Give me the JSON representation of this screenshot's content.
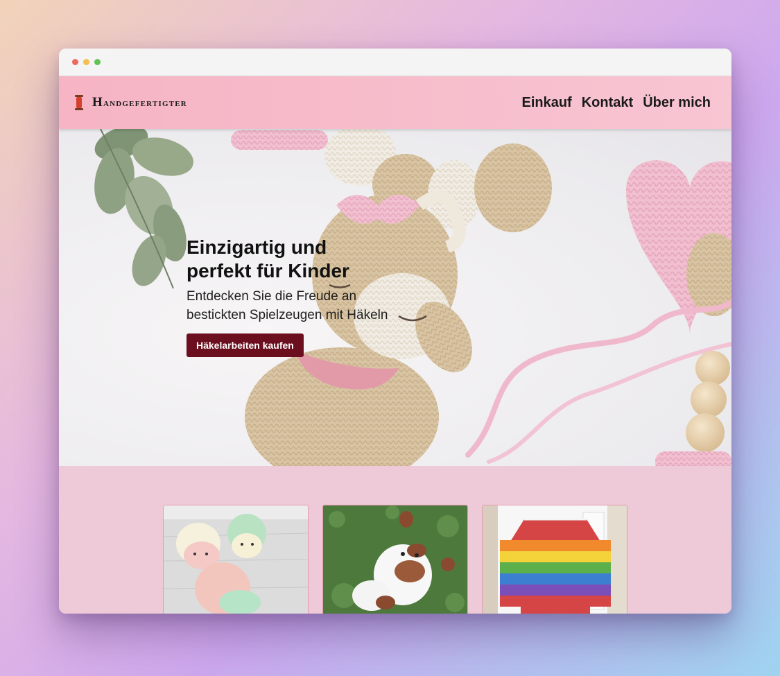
{
  "window": {
    "controls": [
      "close",
      "minimize",
      "maximize"
    ]
  },
  "navbar": {
    "brand_icon": "thread-spool-icon",
    "brand_name": "Handgefertigter",
    "links": [
      {
        "label": "Einkauf"
      },
      {
        "label": "Kontakt"
      },
      {
        "label": "Über mich"
      }
    ]
  },
  "hero": {
    "title_line1": "Einzigartig und",
    "title_line2": "perfekt für Kinder",
    "subtitle_line1": "Entdecken Sie die Freude an",
    "subtitle_line2": "bestickten Spielzeugen mit Häkeln",
    "cta_label": "Häkelarbeiten kaufen",
    "image": "crocheted deer toy with pink heart and teething beads"
  },
  "products": [
    {
      "image": "crocheted turtles"
    },
    {
      "image": "crocheted cow on grass"
    },
    {
      "image": "rainbow striped sweater"
    }
  ],
  "colors": {
    "navbar": "#f6b4c4",
    "page_bg": "#eec9d8",
    "cta_bg": "#6b0e1e",
    "cta_text": "#ffffff"
  }
}
